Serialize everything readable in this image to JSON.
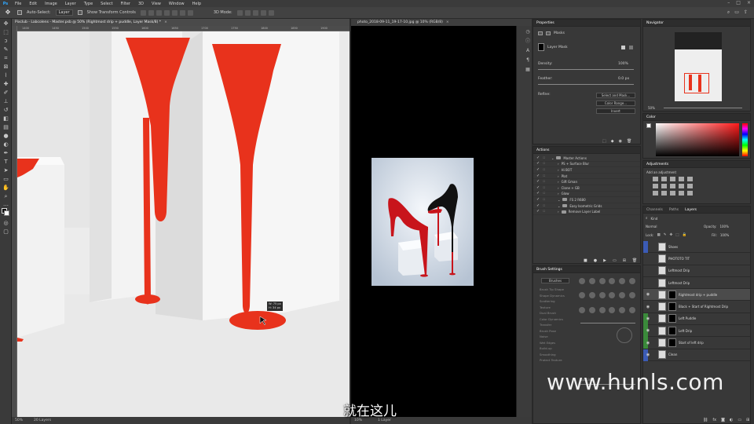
{
  "menubar": {
    "logo": "Ps",
    "items": [
      "File",
      "Edit",
      "Image",
      "Layer",
      "Type",
      "Select",
      "Filter",
      "3D",
      "View",
      "Window",
      "Help"
    ]
  },
  "options": {
    "auto_select": "Auto-Select:",
    "auto_select_target": "Layer",
    "show_transform": "Show Transform Controls",
    "mode_3d": "3D Mode:"
  },
  "doc1": {
    "tab_title": "Pixclub - Labcolens - Master.psb @ 50% (Rightmost drip + puddle, Layer Mask/8) *",
    "rulers": [
      "1400",
      "1450",
      "1500",
      "1550",
      "1600",
      "1650",
      "1700",
      "1750",
      "1800",
      "1850",
      "1900"
    ],
    "info_w": "W: 75 px",
    "info_h": "H: 34 px",
    "zoom": "50%",
    "layers_count": "20 Layers"
  },
  "doc2": {
    "tab_title": "photo_2018-09-11_19-17-10.jpg @ 10% (RGB/8)",
    "zoom": "10%",
    "layers_count": "1 Layer"
  },
  "properties": {
    "title": "Properties",
    "section": "Masks",
    "layer_mask": "Layer Mask",
    "density_label": "Density:",
    "density_value": "100%",
    "feather_label": "Feather:",
    "feather_value": "0.0 px",
    "refine_label": "Refine:",
    "btn_select_mask": "Select and Mask...",
    "btn_color_range": "Color Range...",
    "btn_invert": "Invert"
  },
  "actions": {
    "title": "Actions",
    "items": [
      "Master Actions",
      "PS + Surface Blur",
      "Hi BOT",
      "Plat",
      "Gift Gman",
      "Clone + GB",
      "Glow",
      "FS 2 R680",
      "Easy Isometric Grids",
      "Remove Layer Label"
    ]
  },
  "brush_settings": {
    "title": "Brush Settings",
    "brushes_btn": "Brushes",
    "items": [
      "Brush Tip Shape",
      "Shape Dynamics",
      "Scattering",
      "Texture",
      "Dual Brush",
      "Color Dynamics",
      "Transfer",
      "Brush Pose",
      "Noise",
      "Wet Edges",
      "Build-up",
      "Smoothing",
      "Protect Texture"
    ],
    "spacing_label": "Spacing"
  },
  "navigator": {
    "title": "Navigator",
    "zoom": "50%"
  },
  "color": {
    "title": "Color"
  },
  "adjustments": {
    "title": "Adjustments",
    "subtitle": "Add an adjustment"
  },
  "layers": {
    "tabs": [
      "Channels",
      "Paths",
      "Layers"
    ],
    "kind": "Kind",
    "blend_mode": "Normal",
    "opacity_label": "Opacity:",
    "opacity_value": "100%",
    "lock_label": "Lock:",
    "fill_label": "Fill:",
    "fill_value": "100%",
    "items": [
      {
        "name": "Shoes",
        "tag": "#3b5bb5"
      },
      {
        "name": "PHOTOTO TIT",
        "tag": ""
      },
      {
        "name": "Leftmost Drip",
        "tag": ""
      },
      {
        "name": "Leftmost Drip",
        "tag": ""
      },
      {
        "name": "Rightmost drip + puddle",
        "tag": ""
      },
      {
        "name": "Black + Start of Rightmost Drip",
        "tag": ""
      },
      {
        "name": "Left Puddle",
        "tag": "#3a8a3a"
      },
      {
        "name": "Left Drip",
        "tag": "#3a8a3a"
      },
      {
        "name": "Start of left drip",
        "tag": "#3a8a3a"
      },
      {
        "name": "Clean",
        "tag": "#3b5bb5"
      }
    ]
  },
  "overlay": {
    "watermark": "www.hunls.com",
    "subtitle": "就在这儿"
  },
  "colors": {
    "paint_red": "#e8321c",
    "ps_blue": "#31a8ff"
  }
}
